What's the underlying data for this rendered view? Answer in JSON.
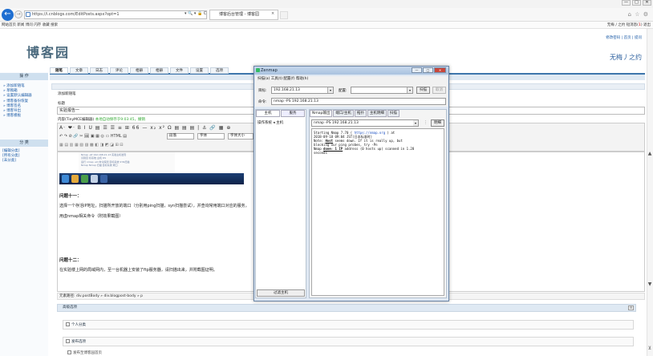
{
  "browser": {
    "url": "https://i.cnblogs.com/EditPosts.aspx?opt=1",
    "address_tools": "▾ 🔍 ▾ 🔒 C",
    "tab_title": "博客后台管理 - 博客园",
    "tab_close": "×",
    "window_controls": [
      "—",
      "□",
      "✕"
    ],
    "back": "←",
    "forward": "→",
    "right_icons": "⌂ ☆ ⚙",
    "favorites_left": "网站首页  新闻  博问  闪存  收藏  搜索",
    "favorites_right": "无梅丿之约  短消息(",
    "favorites_right_count": "1",
    "favorites_right_tail": ")  退出"
  },
  "header": {
    "top_links": "修改密码 | 首页 | 提问",
    "logo_text": "博客园",
    "owner": "无梅丿之约"
  },
  "nav": [
    "随笔",
    "文章",
    "日志",
    "评论",
    "相册",
    "相册",
    "文件",
    "设置",
    "选项"
  ],
  "sidebar": {
    "head1": "操  作",
    "links": [
      "» 添加新随笔",
      "» 草稿箱",
      "» 设置默认编辑器",
      "» 博客备份恢复",
      "» 博客签名",
      "» 博客导出",
      "» 博客模板"
    ],
    "head2": "分  类",
    "cats": [
      "[编辑分类]",
      "[所有分类]",
      "[未分类]"
    ]
  },
  "editor": {
    "section_title": "添加新随笔",
    "title_label": "标题",
    "title_value": "实验报告一",
    "content_label": "内容(TinyMCE编辑器)",
    "autosave": "本地自动保存于9:03:45，撤销",
    "toolbar_row1": "A· ❤· B I U ▤ ☰ ☰ ≡ ⊞ 66 — x₂ x² Ω ▤ ▤ ▤ | ⚓ 🔗 ▦ ⊕",
    "toolbar_row2": "↶ ↷ ⊘ 🔗 ✂ 🖼 ▣ ▦ ◎ ▭ HTML ▤",
    "select_format": "段落",
    "select_font": "字体",
    "select_size": "字体大小",
    "toolbar_row3": "▦ ▤ ▥ ▦ ▧ ▨ ▩ ◧ ◨ ◩ ◪ ⊞ ⊟",
    "embedded_lines": [
      "Nmap -sP 192.168.21.13 实验主机发现",
      "识别目 标系统 主机 OS",
      "运行 nmap -sO 命令探测 目标系统 SYN扫描",
      "Nmap Nmap 扫描 目标系统 端口"
    ],
    "q11_title": "问题十一：",
    "q11_text1": "选择一个存活IP地址，扫描所开放的端口（分别用ping扫描，syn扫描尝试），并查询常用端口对应的服务，",
    "q11_text2": "用虚nmap相关命令（附效果截图）",
    "q12_title": "问题十二：",
    "q12_text1": "在实验楼上网的局域网内，至一台机器上安装了ftp服务器，请扫描出来，并附截图证明。",
    "path": "元素路径: div.postBody » div.blogpost-body » p"
  },
  "options": {
    "advanced": "高级选项",
    "advanced_toggle": "⊟",
    "personal": "个人分类",
    "publish": "发布选项",
    "publish_option": "发布至博客园首页"
  },
  "zenmap": {
    "title": "Zenmap",
    "window_controls": [
      "—",
      "□",
      "✕"
    ],
    "menu": "扫描(a)   工具(t)   配置(f)   帮助(h)",
    "target_label": "目标:",
    "target_value": "192.168.21.13",
    "profile_label": "配置:",
    "scan_button": "扫描",
    "cancel_button": "取消",
    "command_label": "命令:",
    "command_value": "nmap -PS 192.168.21.13",
    "left_tabs": [
      "主机",
      "服务"
    ],
    "os_host_header": "操作系统 ◂  主机",
    "filter_button": "过滤主机",
    "tabs": [
      "Nmap输出",
      "端口/主机",
      "拓扑",
      "主机明细",
      "扫描"
    ],
    "output_select": "nmap -PS 192.168.21.13",
    "detail_button": "明细",
    "output": {
      "l1a": "Starting Nmap 7.70 ( ",
      "l1link": "https://nmap.org",
      "l1b": " ) at",
      "l2": "2018-09-18 09:04 JST(日本标准时)",
      "l3a": "Note: ",
      "l3u": "Host",
      "l3b": " seems down. If it is really up, but",
      "l4": "blocking our ping probes, try -Pn",
      "l5a": "Nmap ",
      "l5u": "done: 1 IP",
      "l5b": " address (0 hosts up) scanned in 1.28",
      "l6": "seconds"
    },
    "up_arrow": "▾",
    "grip": "⋮"
  },
  "scroll": {
    "up": "▲",
    "down": "▼",
    "end": "⊻"
  }
}
